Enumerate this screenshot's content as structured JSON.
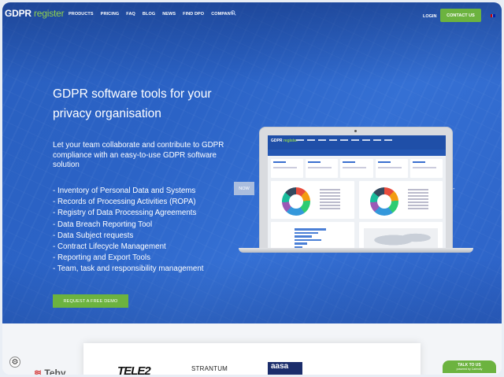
{
  "nav": {
    "logo_main": "GDPR",
    "logo_accent": "register",
    "menu": [
      "PRODUCTS",
      "PRICING",
      "FAQ",
      "BLOG",
      "NEWS",
      "FIND DPO",
      "COMPANY"
    ],
    "login": "LOGIN",
    "contact": "CONTACT US",
    "icons": [
      "search-icon",
      "uk-flag-icon"
    ]
  },
  "hero": {
    "title_line1": "GDPR software tools for your",
    "title_line2": "privacy organisation",
    "intro": "Let your team collaborate and contribute to GDPR compliance with an easy-to-use GDPR software solution",
    "features": [
      "- Inventory of Personal Data and Systems",
      "- Records of Processing Activities (ROPA)",
      "- Registry of Data Processing Agreements",
      "- Data Breach Reporting Tool",
      "- Data Subject requests",
      "- Contract Lifecycle Management",
      "- Reporting and Export Tools",
      "- Team, task and responsibility management"
    ],
    "demo_button": "REQUEST A FREE DEMO",
    "now_badge": "NOW"
  },
  "clients": [
    "Teby",
    "TELE2",
    "STRANTUM",
    "aasa"
  ],
  "cookie_icon": "⚙",
  "chat": {
    "label": "TALK TO US",
    "sub": "powered by Calendly"
  }
}
